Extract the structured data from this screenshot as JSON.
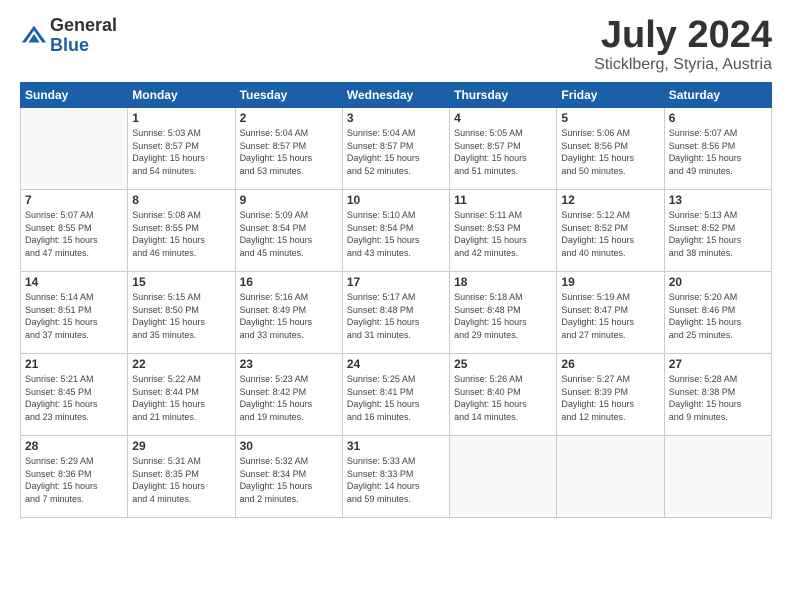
{
  "header": {
    "logo": {
      "general": "General",
      "blue": "Blue"
    },
    "title": "July 2024",
    "location": "Sticklberg, Styria, Austria"
  },
  "days_of_week": [
    "Sunday",
    "Monday",
    "Tuesday",
    "Wednesday",
    "Thursday",
    "Friday",
    "Saturday"
  ],
  "weeks": [
    [
      {
        "day": "",
        "info": ""
      },
      {
        "day": "1",
        "info": "Sunrise: 5:03 AM\nSunset: 8:57 PM\nDaylight: 15 hours\nand 54 minutes."
      },
      {
        "day": "2",
        "info": "Sunrise: 5:04 AM\nSunset: 8:57 PM\nDaylight: 15 hours\nand 53 minutes."
      },
      {
        "day": "3",
        "info": "Sunrise: 5:04 AM\nSunset: 8:57 PM\nDaylight: 15 hours\nand 52 minutes."
      },
      {
        "day": "4",
        "info": "Sunrise: 5:05 AM\nSunset: 8:57 PM\nDaylight: 15 hours\nand 51 minutes."
      },
      {
        "day": "5",
        "info": "Sunrise: 5:06 AM\nSunset: 8:56 PM\nDaylight: 15 hours\nand 50 minutes."
      },
      {
        "day": "6",
        "info": "Sunrise: 5:07 AM\nSunset: 8:56 PM\nDaylight: 15 hours\nand 49 minutes."
      }
    ],
    [
      {
        "day": "7",
        "info": "Sunrise: 5:07 AM\nSunset: 8:55 PM\nDaylight: 15 hours\nand 47 minutes."
      },
      {
        "day": "8",
        "info": "Sunrise: 5:08 AM\nSunset: 8:55 PM\nDaylight: 15 hours\nand 46 minutes."
      },
      {
        "day": "9",
        "info": "Sunrise: 5:09 AM\nSunset: 8:54 PM\nDaylight: 15 hours\nand 45 minutes."
      },
      {
        "day": "10",
        "info": "Sunrise: 5:10 AM\nSunset: 8:54 PM\nDaylight: 15 hours\nand 43 minutes."
      },
      {
        "day": "11",
        "info": "Sunrise: 5:11 AM\nSunset: 8:53 PM\nDaylight: 15 hours\nand 42 minutes."
      },
      {
        "day": "12",
        "info": "Sunrise: 5:12 AM\nSunset: 8:52 PM\nDaylight: 15 hours\nand 40 minutes."
      },
      {
        "day": "13",
        "info": "Sunrise: 5:13 AM\nSunset: 8:52 PM\nDaylight: 15 hours\nand 38 minutes."
      }
    ],
    [
      {
        "day": "14",
        "info": "Sunrise: 5:14 AM\nSunset: 8:51 PM\nDaylight: 15 hours\nand 37 minutes."
      },
      {
        "day": "15",
        "info": "Sunrise: 5:15 AM\nSunset: 8:50 PM\nDaylight: 15 hours\nand 35 minutes."
      },
      {
        "day": "16",
        "info": "Sunrise: 5:16 AM\nSunset: 8:49 PM\nDaylight: 15 hours\nand 33 minutes."
      },
      {
        "day": "17",
        "info": "Sunrise: 5:17 AM\nSunset: 8:48 PM\nDaylight: 15 hours\nand 31 minutes."
      },
      {
        "day": "18",
        "info": "Sunrise: 5:18 AM\nSunset: 8:48 PM\nDaylight: 15 hours\nand 29 minutes."
      },
      {
        "day": "19",
        "info": "Sunrise: 5:19 AM\nSunset: 8:47 PM\nDaylight: 15 hours\nand 27 minutes."
      },
      {
        "day": "20",
        "info": "Sunrise: 5:20 AM\nSunset: 8:46 PM\nDaylight: 15 hours\nand 25 minutes."
      }
    ],
    [
      {
        "day": "21",
        "info": "Sunrise: 5:21 AM\nSunset: 8:45 PM\nDaylight: 15 hours\nand 23 minutes."
      },
      {
        "day": "22",
        "info": "Sunrise: 5:22 AM\nSunset: 8:44 PM\nDaylight: 15 hours\nand 21 minutes."
      },
      {
        "day": "23",
        "info": "Sunrise: 5:23 AM\nSunset: 8:42 PM\nDaylight: 15 hours\nand 19 minutes."
      },
      {
        "day": "24",
        "info": "Sunrise: 5:25 AM\nSunset: 8:41 PM\nDaylight: 15 hours\nand 16 minutes."
      },
      {
        "day": "25",
        "info": "Sunrise: 5:26 AM\nSunset: 8:40 PM\nDaylight: 15 hours\nand 14 minutes."
      },
      {
        "day": "26",
        "info": "Sunrise: 5:27 AM\nSunset: 8:39 PM\nDaylight: 15 hours\nand 12 minutes."
      },
      {
        "day": "27",
        "info": "Sunrise: 5:28 AM\nSunset: 8:38 PM\nDaylight: 15 hours\nand 9 minutes."
      }
    ],
    [
      {
        "day": "28",
        "info": "Sunrise: 5:29 AM\nSunset: 8:36 PM\nDaylight: 15 hours\nand 7 minutes."
      },
      {
        "day": "29",
        "info": "Sunrise: 5:31 AM\nSunset: 8:35 PM\nDaylight: 15 hours\nand 4 minutes."
      },
      {
        "day": "30",
        "info": "Sunrise: 5:32 AM\nSunset: 8:34 PM\nDaylight: 15 hours\nand 2 minutes."
      },
      {
        "day": "31",
        "info": "Sunrise: 5:33 AM\nSunset: 8:33 PM\nDaylight: 14 hours\nand 59 minutes."
      },
      {
        "day": "",
        "info": ""
      },
      {
        "day": "",
        "info": ""
      },
      {
        "day": "",
        "info": ""
      }
    ]
  ]
}
